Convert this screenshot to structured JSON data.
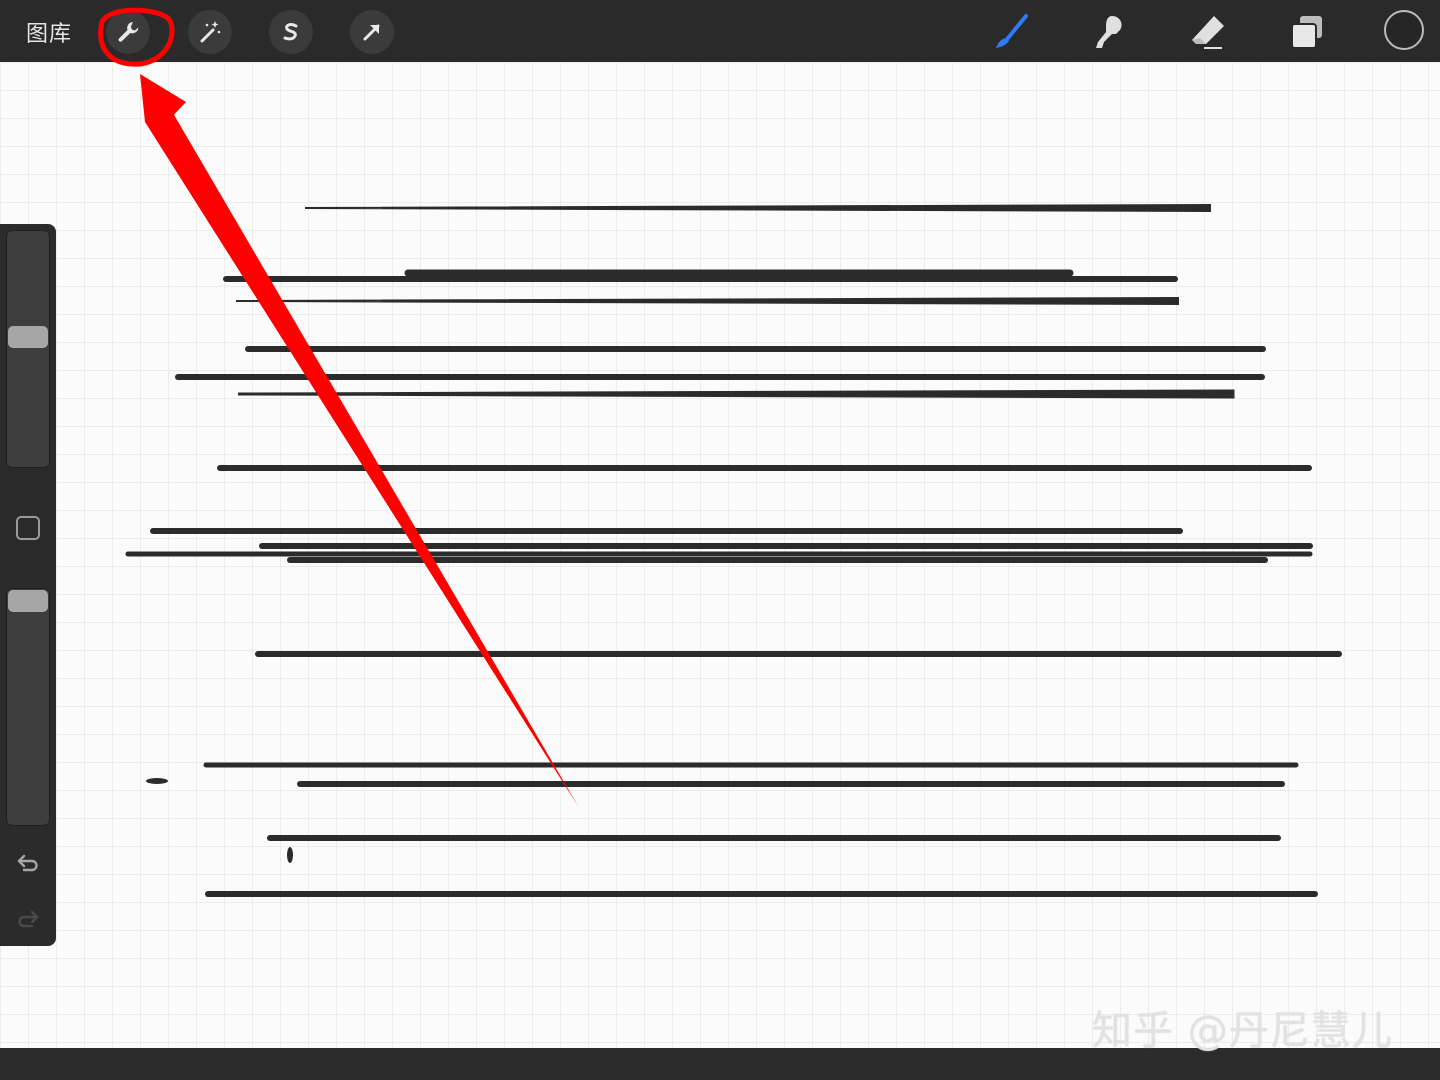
{
  "topbar": {
    "gallery_label": "图库",
    "left_tools": [
      {
        "name": "wrench-icon"
      },
      {
        "name": "magic-wand-icon"
      },
      {
        "name": "selection-s-icon"
      },
      {
        "name": "transform-arrow-icon"
      }
    ],
    "right_tools": [
      {
        "name": "brush-icon",
        "color": "#2f7bf5"
      },
      {
        "name": "smudge-icon"
      },
      {
        "name": "eraser-icon"
      },
      {
        "name": "layers-icon"
      }
    ],
    "current_color": "#262626"
  },
  "sidebar": {
    "brush_size_level": 0.55,
    "opacity_level": 1.0,
    "icons": [
      "modify-square-icon",
      "undo-icon",
      "redo-icon"
    ]
  },
  "annotation": {
    "color": "#ff0000",
    "shape": "red circle and arrow pointing to wrench"
  },
  "watermark": "知乎 @丹尼慧儿"
}
